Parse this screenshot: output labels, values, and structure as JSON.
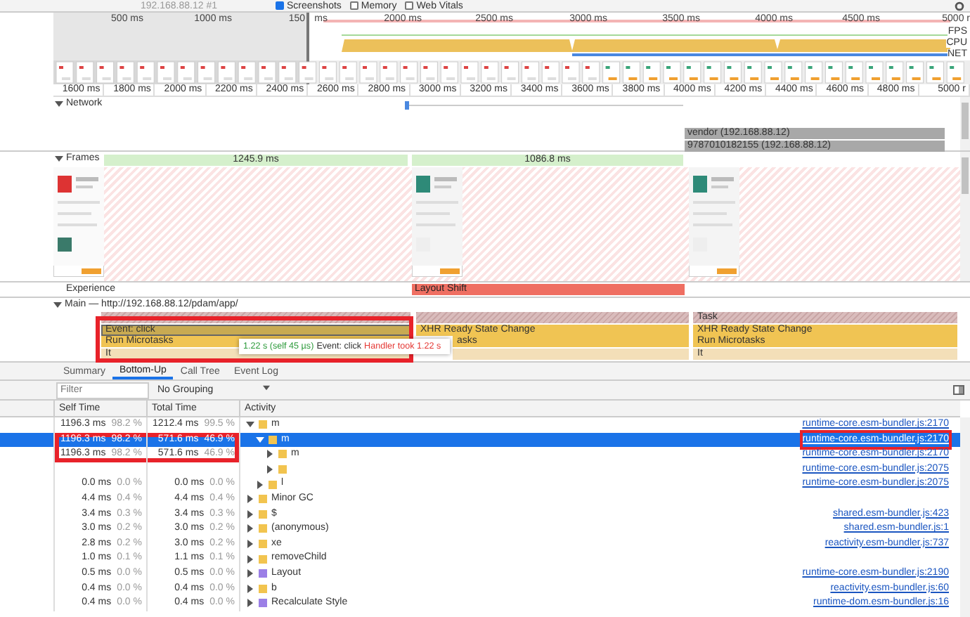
{
  "toolbar": {
    "target": "192.168.88.12 #1",
    "checkboxes": [
      {
        "label": "Screenshots",
        "checked": true
      },
      {
        "label": "Memory",
        "checked": false
      },
      {
        "label": "Web Vitals",
        "checked": false
      }
    ]
  },
  "overview": {
    "ruler": [
      "500 ms",
      "1000 ms",
      "150",
      "ms",
      "2000 ms",
      "2500 ms",
      "3000 ms",
      "3500 ms",
      "4000 ms",
      "4500 ms",
      "5000 r"
    ],
    "tracks": [
      "FPS",
      "CPU",
      "NET"
    ]
  },
  "ruler": [
    "1600 ms",
    "1800 ms",
    "2000 ms",
    "2200 ms",
    "2400 ms",
    "2600 ms",
    "2800 ms",
    "3000 ms",
    "3200 ms",
    "3400 ms",
    "3600 ms",
    "3800 ms",
    "4000 ms",
    "4200 ms",
    "4400 ms",
    "4600 ms",
    "4800 ms",
    "5000 r"
  ],
  "network": {
    "label": "Network",
    "expanded": true,
    "requests": [
      "vendor (192.168.88.12)",
      "9787010182155 (192.168.88.12)"
    ]
  },
  "frames": {
    "label": "Frames",
    "expanded": true,
    "durations": [
      "1245.9 ms",
      "1086.8 ms"
    ]
  },
  "experience": {
    "label": "Experience",
    "events": [
      "Layout Shift"
    ]
  },
  "main": {
    "label": "Main — http://192.168.88.12/pdam/app/",
    "expanded": true,
    "blocks": [
      {
        "entries": [
          {
            "kind": "task"
          },
          {
            "kind": "event",
            "label": "Event: click",
            "selected": true,
            "highlighted": true
          },
          {
            "kind": "microtask",
            "label": "Run Microtasks"
          },
          {
            "kind": "function",
            "label": "It"
          }
        ]
      },
      {
        "entries": [
          {
            "kind": "task"
          },
          {
            "kind": "event",
            "label": "XHR Ready State Change",
            "selected": false,
            "highlighted": false
          },
          {
            "kind": "microtask",
            "label": "asks"
          },
          {
            "kind": "function"
          }
        ]
      },
      {
        "entries": [
          {
            "kind": "task",
            "label": "Task"
          },
          {
            "kind": "event",
            "label": "XHR Ready State Change",
            "selected": false,
            "highlighted": false
          },
          {
            "kind": "microtask",
            "label": "Run Microtasks"
          },
          {
            "kind": "function",
            "label": "It"
          }
        ]
      }
    ],
    "tooltip": {
      "duration": "1.22 s (self 45 µs)",
      "title": "Event: click",
      "warning": "Handler took 1.22 s"
    }
  },
  "tabs": [
    {
      "label": "Summary",
      "selected": false
    },
    {
      "label": "Bottom-Up",
      "selected": true
    },
    {
      "label": "Call Tree",
      "selected": false
    },
    {
      "label": "Event Log",
      "selected": false
    }
  ],
  "filter": {
    "placeholder": "Filter"
  },
  "grouping": {
    "value": "No Grouping"
  },
  "table": {
    "columns": [
      "Self Time",
      "Total Time",
      "Activity"
    ],
    "rows": [
      {
        "self": "1196.3 ms",
        "self_pct": "98.2 %",
        "total": "1212.4 ms",
        "total_pct": "99.5 %",
        "name": "m",
        "color": "#f2c44f",
        "expanded": true,
        "selected": false,
        "highlighted": false,
        "link": "runtime-core.esm-bundler.js:2170",
        "children": [
          {
            "self": "1196.3 ms",
            "self_pct": "98.2 %",
            "total": "571.6 ms",
            "total_pct": "46.9 %",
            "name": "m",
            "color": "#f2c44f",
            "expanded": true,
            "selected": true,
            "highlighted": true,
            "link": "runtime-core.esm-bundler.js:2170",
            "link_highlighted": true,
            "children": [
              {
                "self": "1196.3 ms",
                "self_pct": "98.2 %",
                "total": "571.6 ms",
                "total_pct": "46.9 %",
                "name": "m",
                "color": "#f2c44f",
                "expanded": false,
                "selected": false,
                "highlighted": true,
                "link": "runtime-core.esm-bundler.js:2170"
              },
              {
                "color": "#f2c44f",
                "expanded": false,
                "selected": false,
                "highlighted": false,
                "link": "runtime-core.esm-bundler.js:2075"
              }
            ]
          },
          {
            "self": "0.0 ms",
            "self_pct": "0.0 %",
            "total": "0.0 ms",
            "total_pct": "0.0 %",
            "name": "l",
            "color": "#f2c44f",
            "expanded": false,
            "selected": false,
            "highlighted": false,
            "link": "runtime-core.esm-bundler.js:2075"
          }
        ]
      },
      {
        "self": "4.4 ms",
        "self_pct": "0.4 %",
        "total": "4.4 ms",
        "total_pct": "0.4 %",
        "name": "Minor GC",
        "color": "#f2c44f",
        "expanded": false,
        "selected": false,
        "highlighted": false
      },
      {
        "self": "3.4 ms",
        "self_pct": "0.3 %",
        "total": "3.4 ms",
        "total_pct": "0.3 %",
        "name": "$",
        "color": "#f2c44f",
        "expanded": false,
        "selected": false,
        "highlighted": false,
        "link": "shared.esm-bundler.js:423"
      },
      {
        "self": "3.0 ms",
        "self_pct": "0.2 %",
        "total": "3.0 ms",
        "total_pct": "0.2 %",
        "name": "(anonymous)",
        "color": "#f2c44f",
        "expanded": false,
        "selected": false,
        "highlighted": false,
        "link": "shared.esm-bundler.js:1"
      },
      {
        "self": "2.8 ms",
        "self_pct": "0.2 %",
        "total": "3.0 ms",
        "total_pct": "0.2 %",
        "name": "xe",
        "color": "#f2c44f",
        "expanded": false,
        "selected": false,
        "highlighted": false,
        "link": "reactivity.esm-bundler.js:737"
      },
      {
        "self": "1.0 ms",
        "self_pct": "0.1 %",
        "total": "1.1 ms",
        "total_pct": "0.1 %",
        "name": "removeChild",
        "color": "#f2c44f",
        "expanded": false,
        "selected": false,
        "highlighted": false
      },
      {
        "self": "0.5 ms",
        "self_pct": "0.0 %",
        "total": "0.5 ms",
        "total_pct": "0.0 %",
        "name": "Layout",
        "color": "#9b7fe6",
        "expanded": false,
        "selected": false,
        "highlighted": false,
        "link": "runtime-core.esm-bundler.js:2190"
      },
      {
        "self": "0.4 ms",
        "self_pct": "0.0 %",
        "total": "0.4 ms",
        "total_pct": "0.0 %",
        "name": "b",
        "color": "#f2c44f",
        "expanded": false,
        "selected": false,
        "highlighted": false,
        "link": "reactivity.esm-bundler.js:60"
      },
      {
        "self": "0.4 ms",
        "self_pct": "0.0 %",
        "total": "0.4 ms",
        "total_pct": "0.0 %",
        "name": "Recalculate Style",
        "color": "#9b7fe6",
        "expanded": false,
        "selected": false,
        "highlighted": false,
        "link": "runtime-dom.esm-bundler.js:16"
      }
    ]
  }
}
